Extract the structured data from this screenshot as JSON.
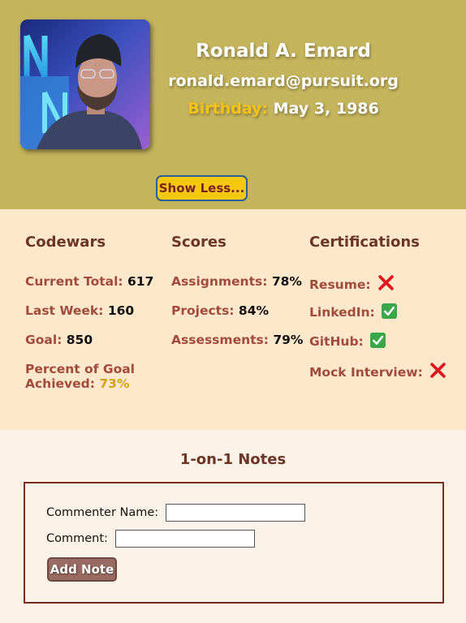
{
  "colors": {
    "header_bg": "#c4b45c",
    "stats_bg": "#fee8cb",
    "page_bg": "#fbf2e8",
    "heading": "#6b3628",
    "label": "#a14a3e",
    "birthday_label": "#f6c21a",
    "toggle_button_bg": "#f5c80e",
    "toggle_button_border": "#2b5f95",
    "add_button_bg": "#9a6b62",
    "notes_border": "#7a2a1c",
    "percent_value": "#d4a11e"
  },
  "profile": {
    "name": "Ronald A. Emard",
    "email": "ronald.emard@pursuit.org",
    "birthday_label": "Birthday:",
    "birthday_value": "May 3, 1986",
    "toggle_label": "Show Less..."
  },
  "codewars": {
    "title": "Codewars",
    "current_total_label": "Current Total:",
    "current_total_value": "617",
    "last_week_label": "Last Week:",
    "last_week_value": "160",
    "goal_label": "Goal:",
    "goal_value": "850",
    "percent_label_line1": "Percent of Goal",
    "percent_label_line2": "Achieved:",
    "percent_value": "73%"
  },
  "scores": {
    "title": "Scores",
    "assignments_label": "Assignments:",
    "assignments_value": "78%",
    "projects_label": "Projects:",
    "projects_value": "84%",
    "assessments_label": "Assessments:",
    "assessments_value": "79%"
  },
  "certifications": {
    "title": "Certifications",
    "items": [
      {
        "label": "Resume:",
        "status": "cross-mark-icon"
      },
      {
        "label": "LinkedIn:",
        "status": "check-mark-icon"
      },
      {
        "label": "GitHub:",
        "status": "check-mark-icon"
      },
      {
        "label": "Mock Interview:",
        "status": "cross-mark-icon"
      }
    ]
  },
  "notes": {
    "title": "1-on-1 Notes",
    "commenter_label": "Commenter Name:",
    "commenter_value": "",
    "comment_label": "Comment:",
    "comment_value": "",
    "add_button_label": "Add Note"
  }
}
